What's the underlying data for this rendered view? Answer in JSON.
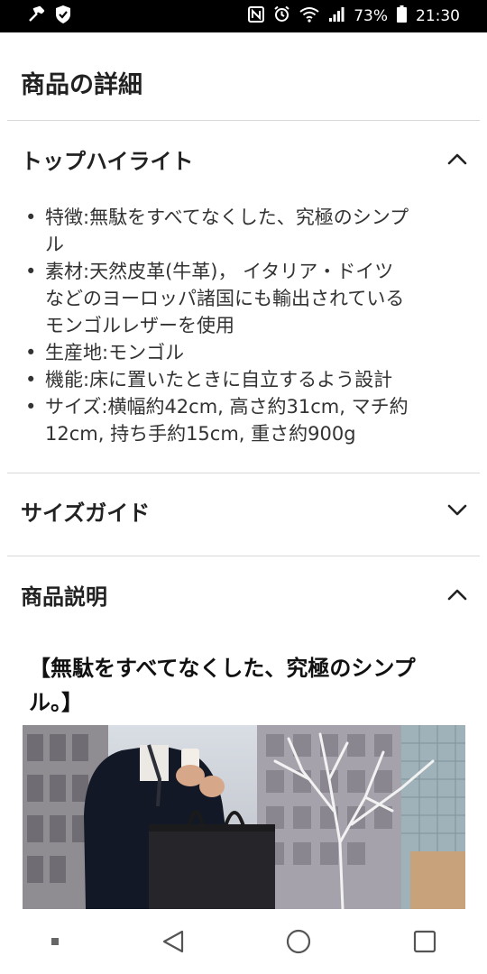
{
  "status_bar": {
    "battery": "73%",
    "time": "21:30"
  },
  "page": {
    "title": "商品の詳細"
  },
  "sections": [
    {
      "title": "トップハイライト",
      "expanded": true
    },
    {
      "title": "サイズガイド",
      "expanded": false
    },
    {
      "title": "商品説明",
      "expanded": true
    }
  ],
  "highlights": [
    {
      "lines": [
        "特徴:無駄をすべてなくした、究極のシンプ",
        "ル"
      ]
    },
    {
      "lines": [
        "素材:天然皮革(牛革)， イタリア・ドイツ",
        "などのヨーロッパ諸国にも輸出されている",
        "モンゴルレザーを使用"
      ]
    },
    {
      "lines": [
        "生産地:モンゴル"
      ]
    },
    {
      "lines": [
        "機能:床に置いたときに自立するよう設計"
      ]
    },
    {
      "lines": [
        "サイズ:横幅約42cm, 高さ約31cm, マチ約",
        "12cm, 持ち手約15cm, 重さ約900g"
      ]
    }
  ],
  "bullet_char": "•",
  "description": {
    "heading_lines": [
      "【無駄をすべてなくした、究極のシンプ",
      "ル。】"
    ]
  },
  "icons": {
    "status_left": [
      "hammer-icon",
      "shield-check-icon"
    ],
    "status_right": [
      "nfc-icon",
      "alarm-icon",
      "wifi-icon",
      "signal-icon",
      "battery-icon"
    ],
    "nav": [
      "recent-dot-icon",
      "back-icon",
      "home-icon",
      "overview-icon"
    ]
  }
}
